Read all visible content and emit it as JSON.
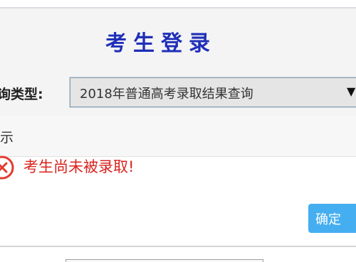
{
  "login_panel": {
    "title": "考生登录",
    "query_type_label": "询类型:",
    "query_type_selected": "2018年普通高考录取结果查询",
    "dropdown_icon": "triangle-down"
  },
  "result_notice": {
    "title": "示",
    "status_icon": "error-circle-x",
    "message": "考生尚未被录取!",
    "message_color": "#d9231e"
  },
  "actions": {
    "confirm_label": "确定",
    "confirm_color": "#45aef0"
  }
}
